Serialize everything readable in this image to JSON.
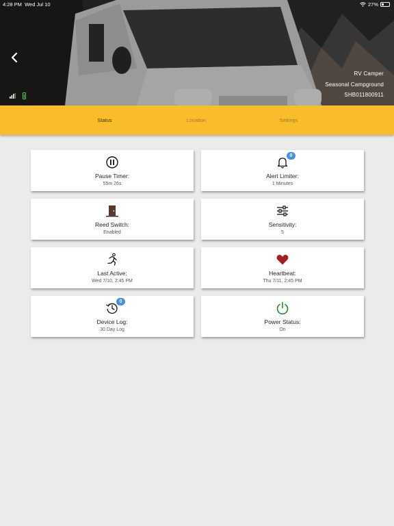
{
  "status_bar": {
    "time": "4:28 PM",
    "date": "Wed Jul 10",
    "battery": "27%"
  },
  "hero": {
    "device_name": "RV Camper",
    "location_name": "Seasonal Campground",
    "serial": "SHB011800911",
    "icons": [
      "chevron-left-icon",
      "signal-icon",
      "battery-icon"
    ]
  },
  "tabs": [
    {
      "label": "Status",
      "active": true
    },
    {
      "label": "Location",
      "active": false
    },
    {
      "label": "Settings",
      "active": false
    }
  ],
  "cards": {
    "pause_timer": {
      "title": "Pause Timer:",
      "value": "55m 26s",
      "icon": "pause-icon"
    },
    "alert_limiter": {
      "title": "Alert Limiter:",
      "value": "1 Minutes",
      "icon": "bell-icon",
      "badge": "0"
    },
    "reed_switch": {
      "title": "Reed Switch:",
      "value": "Enabled",
      "icon": "door-icon"
    },
    "sensitivity": {
      "title": "Sensitivity:",
      "value": "5",
      "icon": "sliders-icon"
    },
    "last_active": {
      "title": "Last Active:",
      "value": "Wed 7/10, 2:45 PM",
      "icon": "running-icon"
    },
    "heartbeat": {
      "title": "Heartbeat:",
      "value": "Thu 7/11, 2:45 PM",
      "icon": "heart-icon"
    },
    "device_log": {
      "title": "Device Log:",
      "value": "30 Day Log",
      "icon": "history-icon",
      "badge": "0"
    },
    "power_status": {
      "title": "Power Status:",
      "value": "On",
      "icon": "power-icon"
    }
  },
  "colors": {
    "accent": "#f9bd2c",
    "badge": "#4a90e2",
    "heart": "#a31f1f",
    "power": "#1e8c28",
    "door": "#5a3a2e"
  }
}
